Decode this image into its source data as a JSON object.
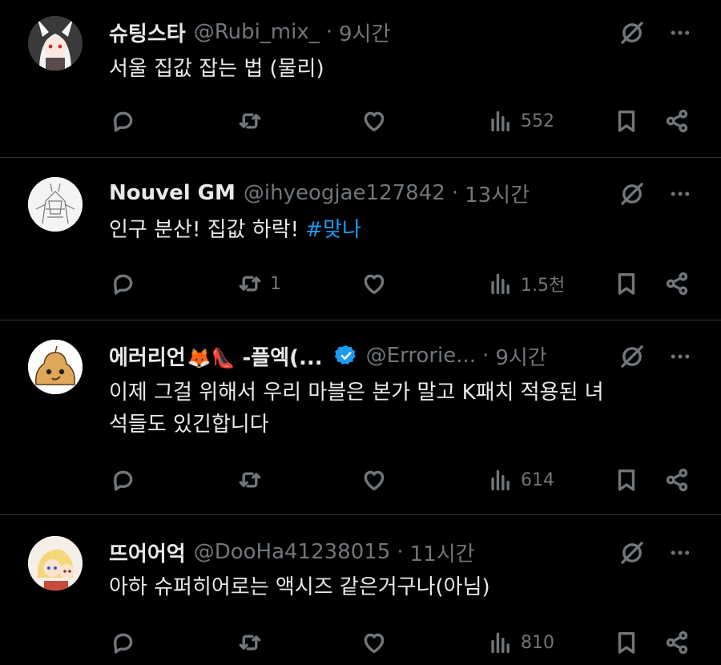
{
  "tweets": [
    {
      "name": "슈팅스타",
      "handle": "@Rubi_mix_",
      "time": "9시간",
      "text": "서울 집값 잡는 법 (물리)",
      "replies": "",
      "retweets": "",
      "views": "552"
    },
    {
      "name": "Nouvel GM",
      "handle": "@ihyeogjae127842",
      "time": "13시간",
      "text": "인구 분산! 집값 하락! ",
      "hashtag": "#맞나",
      "replies": "",
      "retweets": "1",
      "views": "1.5천"
    },
    {
      "name": "에러리언",
      "name_emoji": "🦊👠",
      "name_suffix": " -플엑(...",
      "handle": "@Errorie...",
      "time": "9시간",
      "text_line1": "이제 그걸 위해서 우리 마블은 본가 말고 K패치 적용된 녀",
      "text_line2": "석들도 있긴합니다",
      "replies": "",
      "retweets": "",
      "views": "614"
    },
    {
      "name": "뜨어어억",
      "handle": "@DooHa41238015",
      "time": "11시간",
      "text": "아하 슈퍼히어로는 액시즈 같은거구나(아님)",
      "replies": "",
      "retweets": "",
      "views": "810"
    }
  ],
  "colors": {
    "background": "#000000",
    "text": "#e7e9ea",
    "muted": "#71767b",
    "link": "#1d9bf0",
    "divider": "#2f3336",
    "verified": "#1d9bf0"
  },
  "icons": [
    "reply-icon",
    "retweet-icon",
    "like-icon",
    "views-icon",
    "bookmark-icon",
    "share-icon",
    "grok-icon",
    "more-icon",
    "verified-badge-icon"
  ]
}
